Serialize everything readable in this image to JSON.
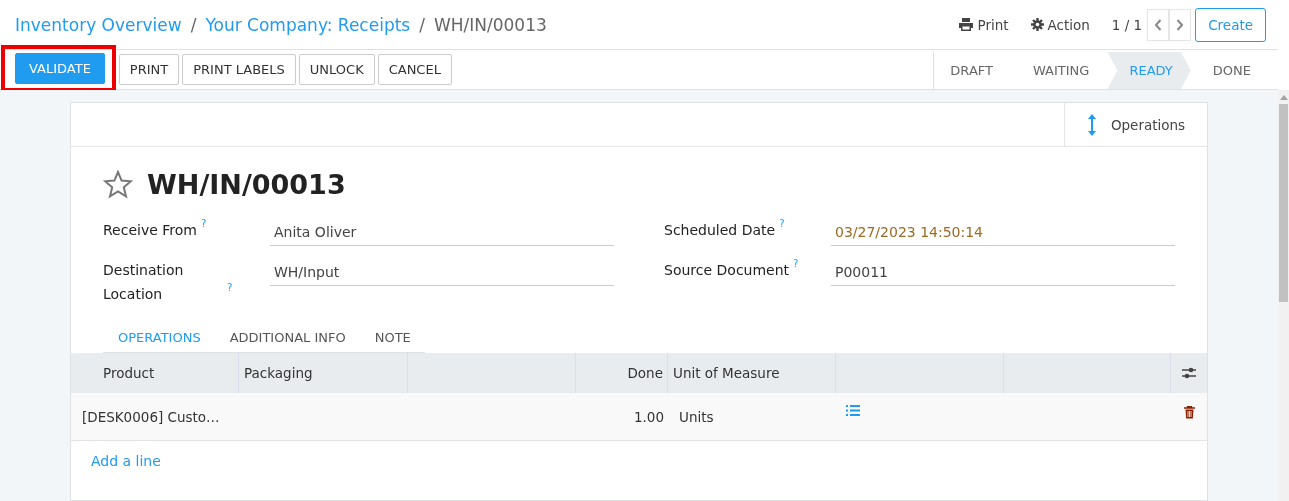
{
  "breadcrumbs": [
    {
      "label": "Inventory Overview",
      "kind": "link"
    },
    {
      "label": "Your Company: Receipts",
      "kind": "link"
    },
    {
      "label": "WH/IN/00013",
      "kind": "current"
    }
  ],
  "breadcrumb_separators": [
    "/",
    "/"
  ],
  "top_actions": [
    {
      "label": "Print",
      "kind": "print"
    },
    {
      "label": "Action",
      "kind": "gear"
    }
  ],
  "pager": {
    "counter": "1 / 1"
  },
  "create_button": "Create",
  "buttons": [
    {
      "label": "VALIDATE",
      "primary": true,
      "highlighted": true
    },
    {
      "label": "PRINT",
      "primary": false,
      "highlighted": false
    },
    {
      "label": "PRINT LABELS",
      "primary": false,
      "highlighted": false
    },
    {
      "label": "UNLOCK",
      "primary": false,
      "highlighted": false
    },
    {
      "label": "CANCEL",
      "primary": false,
      "highlighted": false
    }
  ],
  "status_steps": [
    {
      "label": "DRAFT",
      "selected": false
    },
    {
      "label": "WAITING",
      "selected": false
    },
    {
      "label": "READY",
      "selected": true
    },
    {
      "label": "DONE",
      "selected": false
    }
  ],
  "smart_button": "Operations",
  "record": {
    "title": "WH/IN/00013",
    "starred": false
  },
  "fields_left": [
    {
      "label": "Receive From",
      "help": "?",
      "value": "Anita Oliver",
      "kind": "text"
    },
    {
      "label": "Destination Location",
      "help": "?",
      "value": "WH/Input",
      "kind": "text"
    }
  ],
  "fields_right": [
    {
      "label": "Scheduled Date",
      "help": "?",
      "value": "03/27/2023 14:50:14",
      "kind": "date"
    },
    {
      "label": "Source Document",
      "help": "?",
      "value": "P00011",
      "kind": "text"
    }
  ],
  "tabs": [
    {
      "label": "OPERATIONS",
      "selected": true
    },
    {
      "label": "ADDITIONAL INFO",
      "selected": false
    },
    {
      "label": "NOTE",
      "selected": false
    }
  ],
  "table": {
    "columns": [
      {
        "label": "Product",
        "kind": "text"
      },
      {
        "label": "Packaging",
        "kind": "text"
      },
      {
        "kind": "text"
      },
      {
        "label": "Done",
        "kind": "numeric"
      },
      {
        "label": "Unit of Measure",
        "kind": "text"
      },
      {
        "kind": "text"
      },
      {
        "kind": "text"
      }
    ],
    "rows": [
      {
        "product": "[DESK0006] Custo…",
        "done": "1.00",
        "unit": "Units"
      }
    ],
    "add_line": "Add a line"
  }
}
